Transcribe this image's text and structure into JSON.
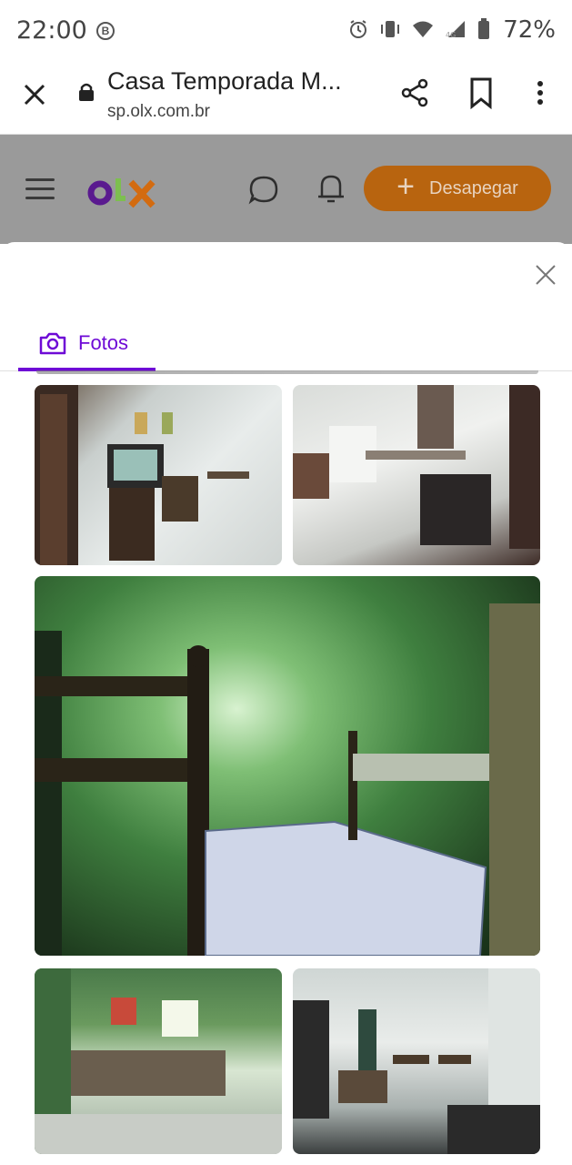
{
  "status_bar": {
    "time": "22:00",
    "b_badge": "B",
    "battery": "72%",
    "icons": [
      "alarm-icon",
      "vibrate-icon",
      "wifi-icon",
      "signal-icon",
      "battery-icon"
    ]
  },
  "browser": {
    "title": "Casa Temporada M...",
    "url": "sp.olx.com.br"
  },
  "olx_header": {
    "logo_letters": [
      "o",
      "l",
      "x"
    ],
    "logo_colors": [
      "#6e0ad6",
      "#8ce563",
      "#f28000"
    ],
    "publish_label": "Desapegar",
    "publish_color": "#f28000"
  },
  "sheet": {
    "tab_label": "Fotos",
    "accent": "#6e0ad6"
  },
  "photos": [
    {
      "scene": "living-room-with-tv"
    },
    {
      "scene": "kitchen-with-stove"
    },
    {
      "scene": "bedroom-with-bunk-beds"
    },
    {
      "scene": "room-with-window-and-sofa"
    },
    {
      "scene": "hallway-and-kitchen"
    }
  ]
}
